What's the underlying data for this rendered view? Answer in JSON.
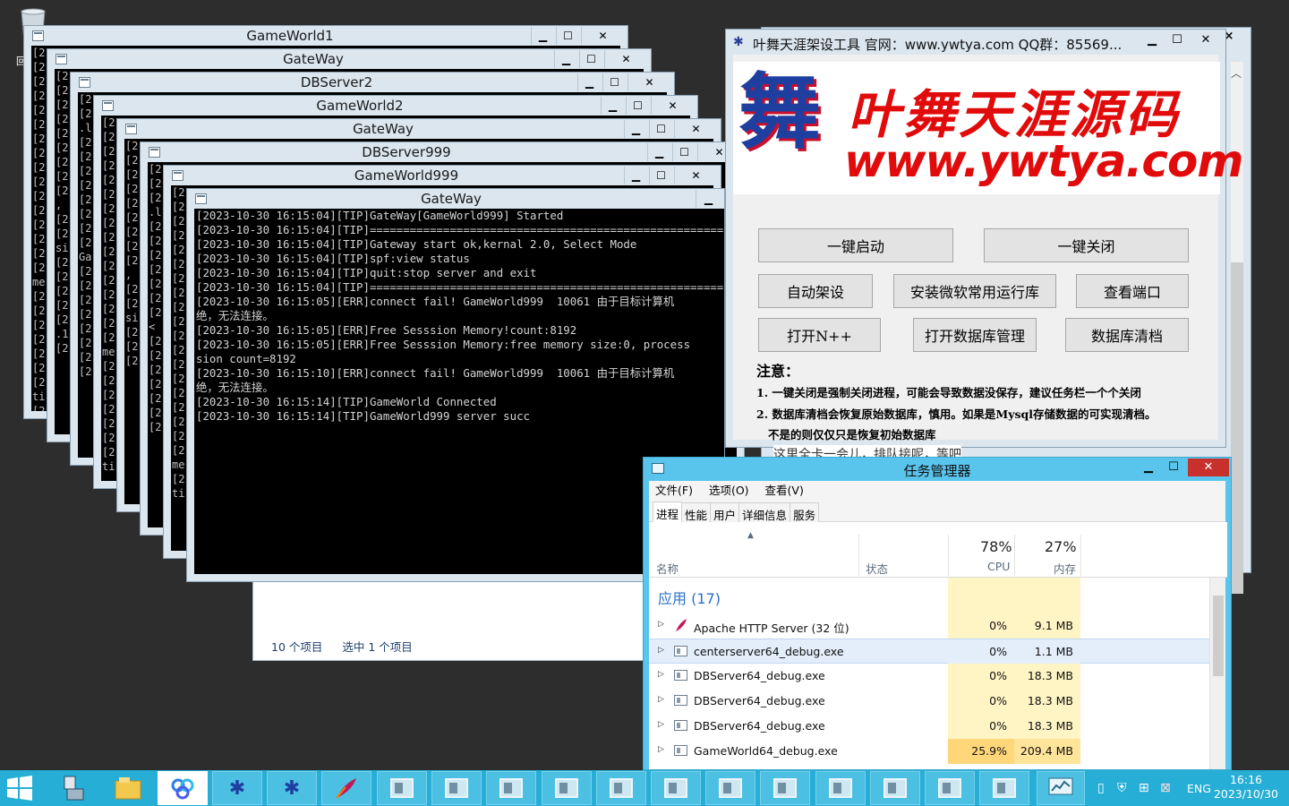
{
  "desktop": {
    "recycle_label": "回"
  },
  "consoles": [
    {
      "title": "GameWorld1",
      "prefixes": [
        "[2",
        "[2",
        "[2",
        "[2",
        "[2",
        "[2",
        "[2",
        "[2",
        "[2",
        "[2",
        "[2",
        "[2",
        "[2",
        "[2",
        "[2",
        "[2",
        "me",
        "[2",
        "[2",
        "[2",
        "[2",
        "[2",
        "[2",
        "[2",
        "ti",
        "[2"
      ]
    },
    {
      "title": "GateWay",
      "prefixes": [
        "[2",
        "[2",
        "[2",
        "[2",
        "[2",
        "[2",
        "[2",
        "[2",
        "[2",
        ",",
        "[2",
        "[2",
        "si",
        "[2",
        "[2",
        "[2",
        "[2",
        "[2",
        ".1",
        "[2"
      ]
    },
    {
      "title": "DBServer2",
      "prefixes": [
        "[2",
        "[2",
        ".l",
        "[2",
        "[2",
        "[2",
        "[2",
        "[2",
        "[2",
        "[2",
        "[2",
        "Ga",
        "[2",
        "[2",
        "[2",
        "[2",
        "[2",
        "[2",
        "[2",
        "[2"
      ]
    },
    {
      "title": "GameWorld2",
      "prefixes": [
        "[2",
        "[2",
        "[2",
        "[2",
        "[2",
        "[2",
        "[2",
        "[2",
        "[2",
        "[2",
        "[2",
        "[2",
        "[2",
        "[2",
        "[2",
        "[2",
        "me",
        "[2",
        "[2",
        "[2",
        "[2",
        "[2",
        "[2",
        "[2",
        "ti"
      ]
    },
    {
      "title": "GateWay",
      "prefixes": [
        "[2",
        "[2",
        "[2",
        "[2",
        "[2",
        "[2",
        "[2",
        "[2",
        "[2",
        ",",
        "[2",
        "[2",
        "si",
        "[2",
        "[2",
        "[2"
      ]
    },
    {
      "title": "DBServer999",
      "prefixes": [
        "[2",
        "[2",
        "[2",
        ".l",
        "[2",
        "[2",
        "[2",
        "[2",
        "[2",
        "[2",
        "[2",
        "<",
        "[2",
        "[2",
        "[2",
        "[2",
        "[2",
        "[2",
        "[2"
      ]
    },
    {
      "title": "GameWorld999",
      "prefixes": [
        "[2",
        "[2",
        "[2",
        "[2",
        "[2",
        "[2",
        "[2",
        "[2",
        "[2",
        "[2",
        "[2",
        "[2",
        "[2",
        "[2",
        "[2",
        "[2",
        "[2",
        "[2",
        "[2",
        "me",
        "[2",
        "ti"
      ]
    }
  ],
  "main_console": {
    "title": "GateWay",
    "log": [
      "[2023-10-30 16:15:04][TIP]GateWay[GameWorld999] Started",
      "[2023-10-30 16:15:04][TIP]=====================================================",
      "[2023-10-30 16:15:04][TIP]Gateway start ok,kernal 2.0, Select Mode",
      "[2023-10-30 16:15:04][TIP]spf:view status",
      "[2023-10-30 16:15:04][TIP]quit:stop server and exit",
      "[2023-10-30 16:15:04][TIP]=====================================================",
      "[2023-10-30 16:15:05][ERR]connect fail! GameWorld999  10061 由于目标计算机",
      "绝，无法连接。",
      "[2023-10-30 16:15:05][ERR]Free Sesssion Memory!count:8192",
      "[2023-10-30 16:15:05][ERR]Free Sesssion Memory:free memory size:0, process",
      "sion count=8192",
      "[2023-10-30 16:15:10][ERR]connect fail! GameWorld999  10061 由于目标计算机",
      "绝，无法连接。",
      "[2023-10-30 16:15:14][TIP]GameWorld Connected",
      "[2023-10-30 16:15:14][TIP]GameWorld999 server succ"
    ]
  },
  "explorer": {
    "item_count": "10 个项目",
    "selected": "选中 1 个项目"
  },
  "back_window": {
    "text": "这里全卡一会儿，排队接呢，等吧"
  },
  "tool": {
    "title": "叶舞天涯架设工具  官网：www.ywtya.com   QQ群：85569...",
    "banner_cn": "叶舞天涯源码",
    "banner_url": "www.ywtya.com",
    "logo_glyph": "舞",
    "buttons": {
      "start_all": "一键启动",
      "close_all": "一键关闭",
      "auto_setup": "自动架设",
      "install_runtime": "安装微软常用运行库",
      "check_port": "查看端口",
      "open_npp": "打开N++",
      "open_db": "打开数据库管理",
      "clear_db": "数据库清档"
    },
    "note_title": "注意：",
    "notes": [
      "1. 一键关闭是强制关闭进程，可能会导致数据没保存，建议任务栏一个个关闭",
      "2. 数据库清档会恢复原始数据库，慎用。如果是Mysql存储数据的可实现清档。",
      "   不是的则仅仅只是恢复初始数据库"
    ]
  },
  "taskmgr": {
    "title": "任务管理器",
    "menu": [
      "文件(F)",
      "选项(O)",
      "查看(V)"
    ],
    "tabs": [
      "进程",
      "性能",
      "用户",
      "详细信息",
      "服务"
    ],
    "active_tab": "进程",
    "col_name": "名称",
    "col_status": "状态",
    "cpu_pct": "78%",
    "cpu_label": "CPU",
    "mem_pct": "27%",
    "mem_label": "内存",
    "group": "应用 (17)",
    "rows": [
      {
        "name": "Apache HTTP Server (32 位)",
        "cpu": "0%",
        "mem": "9.1 MB"
      },
      {
        "name": "centerserver64_debug.exe",
        "cpu": "0%",
        "mem": "1.1 MB"
      },
      {
        "name": "DBServer64_debug.exe",
        "cpu": "0%",
        "mem": "18.3 MB"
      },
      {
        "name": "DBServer64_debug.exe",
        "cpu": "0%",
        "mem": "18.3 MB"
      },
      {
        "name": "DBServer64_debug.exe",
        "cpu": "0%",
        "mem": "18.3 MB"
      },
      {
        "name": "GameWorld64_debug.exe",
        "cpu": "25.9%",
        "mem": "209.4 MB"
      }
    ]
  },
  "taskbar": {
    "lang": "ENG",
    "time": "16:16",
    "date": "2023/10/30"
  }
}
